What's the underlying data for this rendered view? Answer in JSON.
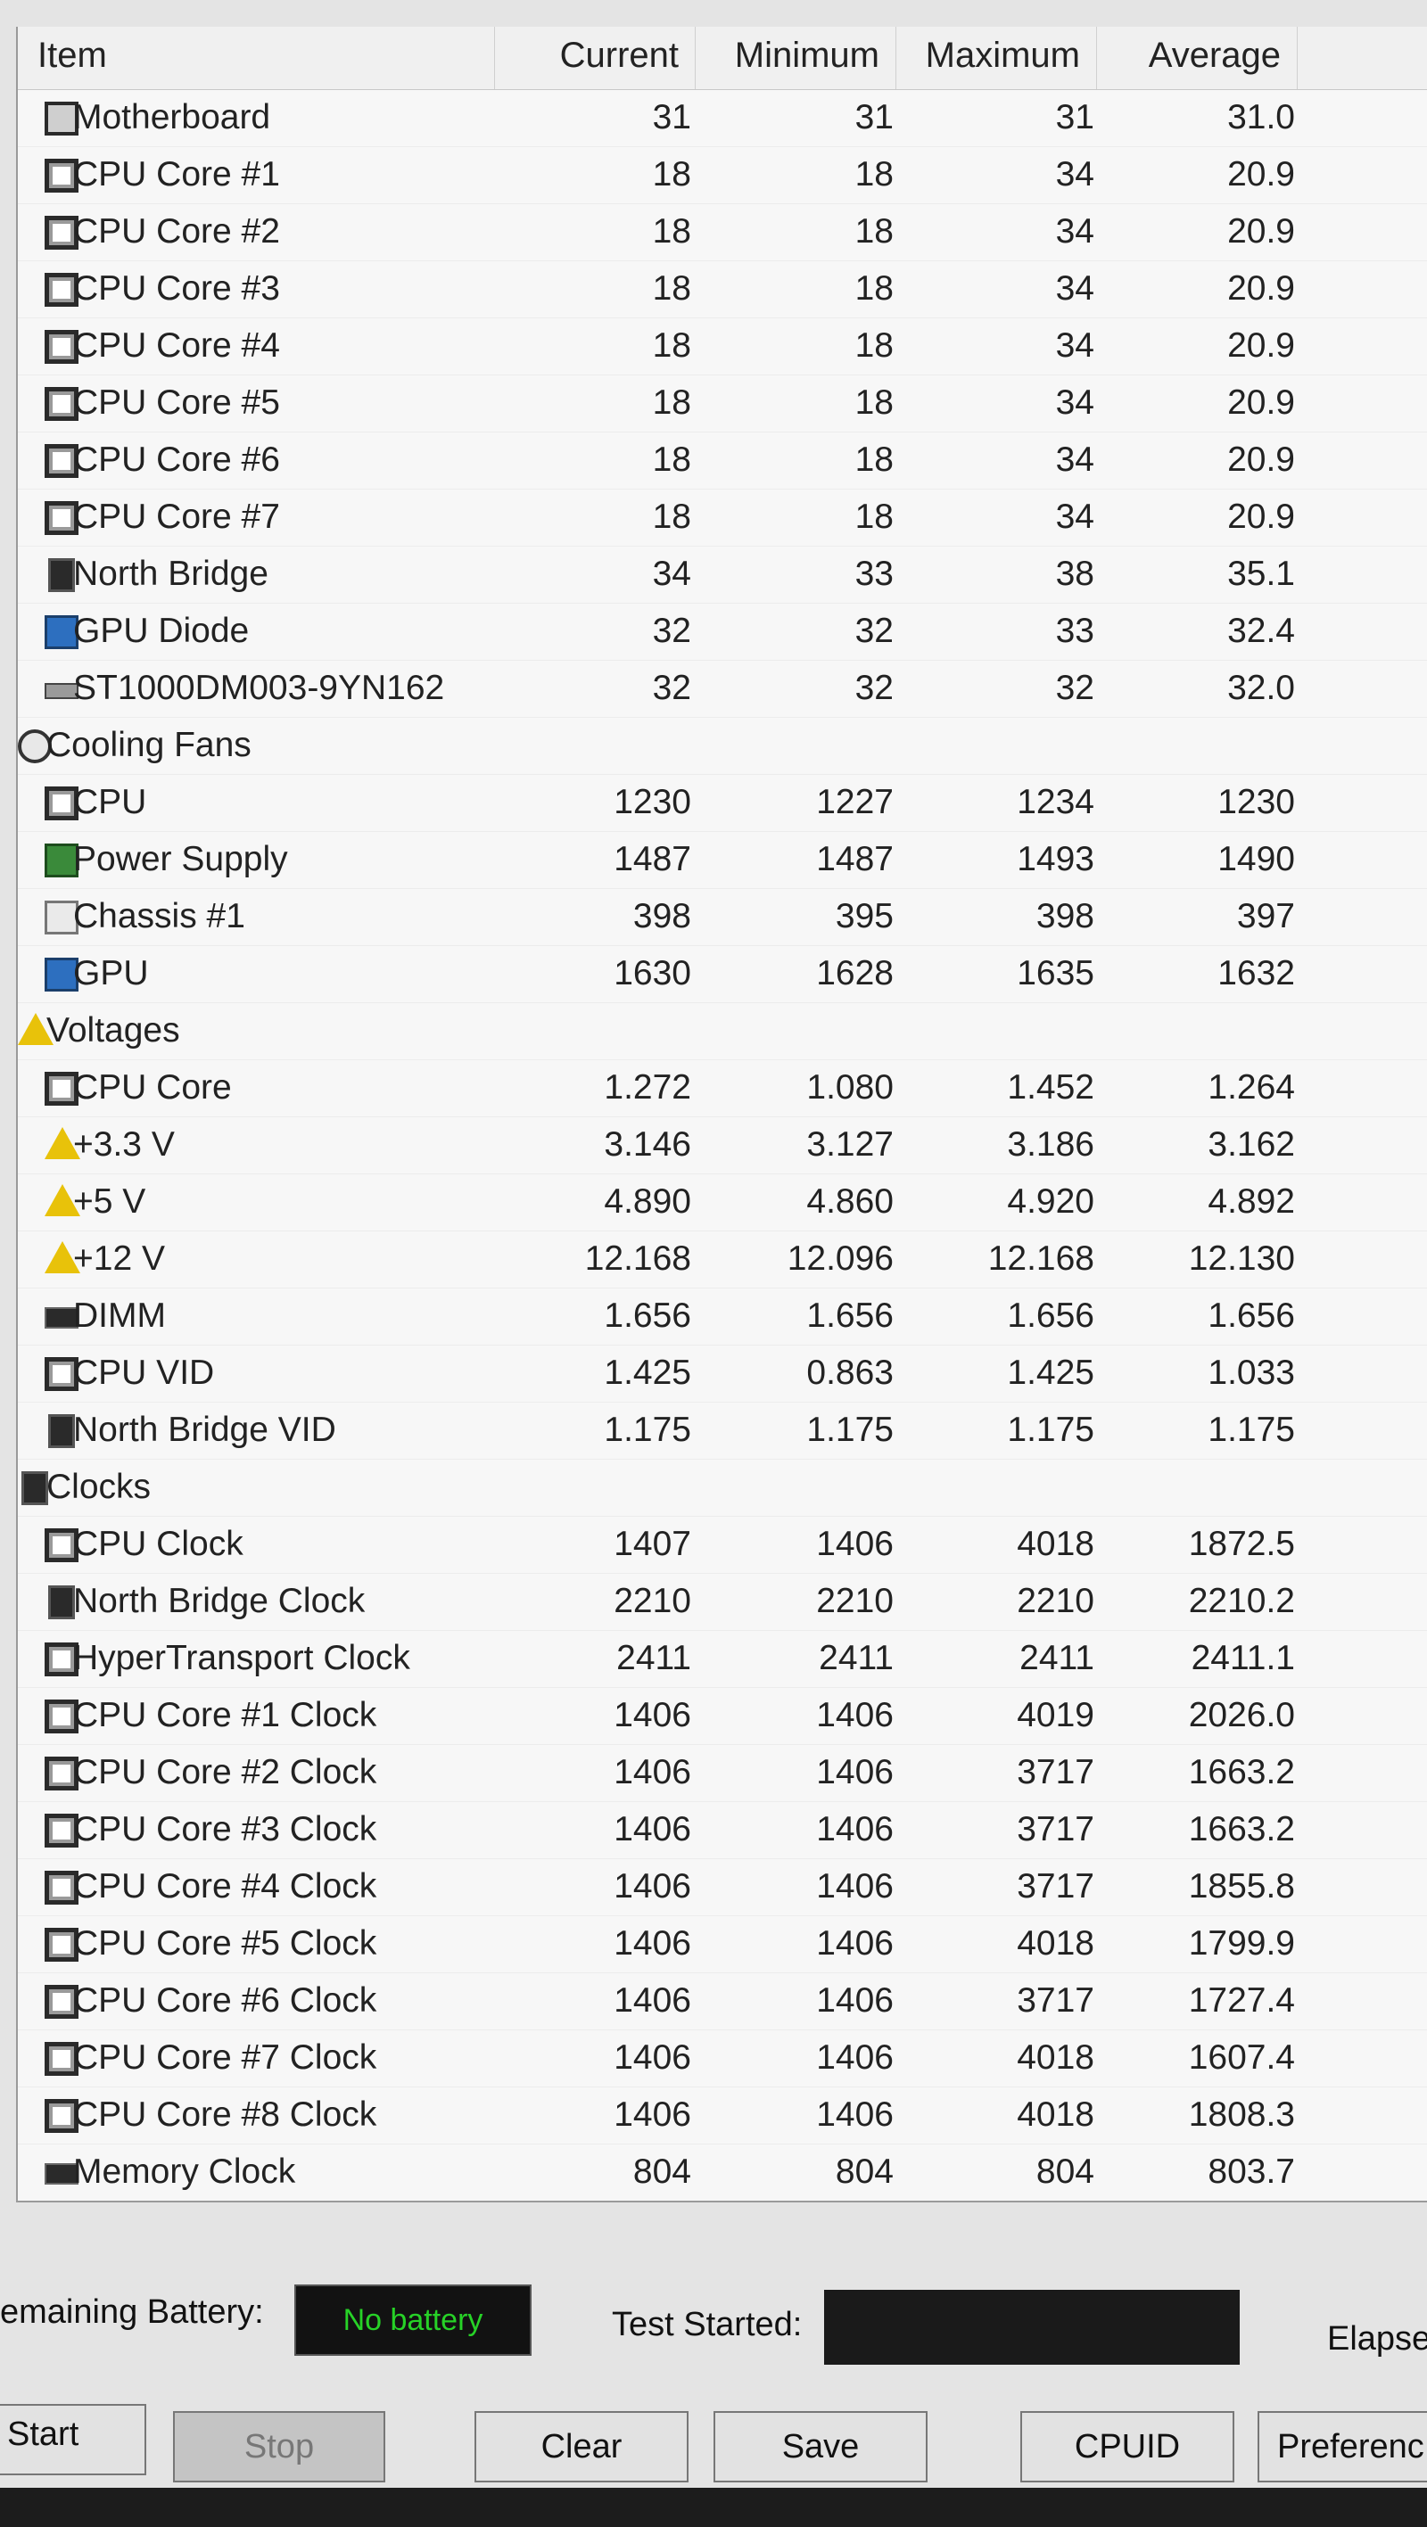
{
  "columns": {
    "item": "Item",
    "current": "Current",
    "minimum": "Minimum",
    "maximum": "Maximum",
    "average": "Average"
  },
  "rows": [
    {
      "label": "Motherboard",
      "level": 1,
      "icon": "motherboard-icon",
      "cur": "31",
      "min": "31",
      "max": "31",
      "avg": "31.0"
    },
    {
      "label": "CPU Core #1",
      "level": 1,
      "icon": "cpu-chip-icon",
      "cur": "18",
      "min": "18",
      "max": "34",
      "avg": "20.9"
    },
    {
      "label": "CPU Core #2",
      "level": 1,
      "icon": "cpu-chip-icon",
      "cur": "18",
      "min": "18",
      "max": "34",
      "avg": "20.9"
    },
    {
      "label": "CPU Core #3",
      "level": 1,
      "icon": "cpu-chip-icon",
      "cur": "18",
      "min": "18",
      "max": "34",
      "avg": "20.9"
    },
    {
      "label": "CPU Core #4",
      "level": 1,
      "icon": "cpu-chip-icon",
      "cur": "18",
      "min": "18",
      "max": "34",
      "avg": "20.9"
    },
    {
      "label": "CPU Core #5",
      "level": 1,
      "icon": "cpu-chip-icon",
      "cur": "18",
      "min": "18",
      "max": "34",
      "avg": "20.9"
    },
    {
      "label": "CPU Core #6",
      "level": 1,
      "icon": "cpu-chip-icon",
      "cur": "18",
      "min": "18",
      "max": "34",
      "avg": "20.9"
    },
    {
      "label": "CPU Core #7",
      "level": 1,
      "icon": "cpu-chip-icon",
      "cur": "18",
      "min": "18",
      "max": "34",
      "avg": "20.9"
    },
    {
      "label": "North Bridge",
      "level": 1,
      "icon": "north-bridge-icon",
      "cur": "34",
      "min": "33",
      "max": "38",
      "avg": "35.1"
    },
    {
      "label": "GPU Diode",
      "level": 1,
      "icon": "gpu-icon",
      "cur": "32",
      "min": "32",
      "max": "33",
      "avg": "32.4"
    },
    {
      "label": "ST1000DM003-9YN162",
      "level": 1,
      "icon": "hard-drive-icon",
      "cur": "32",
      "min": "32",
      "max": "32",
      "avg": "32.0"
    },
    {
      "label": "Cooling Fans",
      "level": 0,
      "icon": "fan-icon",
      "cur": "",
      "min": "",
      "max": "",
      "avg": ""
    },
    {
      "label": "CPU",
      "level": 1,
      "icon": "cpu-chip-icon",
      "cur": "1230",
      "min": "1227",
      "max": "1234",
      "avg": "1230"
    },
    {
      "label": "Power Supply",
      "level": 1,
      "icon": "power-supply-icon",
      "cur": "1487",
      "min": "1487",
      "max": "1493",
      "avg": "1490"
    },
    {
      "label": "Chassis #1",
      "level": 1,
      "icon": "chassis-icon",
      "cur": "398",
      "min": "395",
      "max": "398",
      "avg": "397"
    },
    {
      "label": "GPU",
      "level": 1,
      "icon": "gpu-icon",
      "cur": "1630",
      "min": "1628",
      "max": "1635",
      "avg": "1632"
    },
    {
      "label": "Voltages",
      "level": 0,
      "icon": "warning-icon",
      "cur": "",
      "min": "",
      "max": "",
      "avg": ""
    },
    {
      "label": "CPU Core",
      "level": 1,
      "icon": "cpu-chip-icon",
      "cur": "1.272",
      "min": "1.080",
      "max": "1.452",
      "avg": "1.264"
    },
    {
      "label": "+3.3 V",
      "level": 1,
      "icon": "warning-icon",
      "cur": "3.146",
      "min": "3.127",
      "max": "3.186",
      "avg": "3.162"
    },
    {
      "label": "+5 V",
      "level": 1,
      "icon": "warning-icon",
      "cur": "4.890",
      "min": "4.860",
      "max": "4.920",
      "avg": "4.892"
    },
    {
      "label": "+12 V",
      "level": 1,
      "icon": "warning-icon",
      "cur": "12.168",
      "min": "12.096",
      "max": "12.168",
      "avg": "12.130"
    },
    {
      "label": "DIMM",
      "level": 1,
      "icon": "memory-icon",
      "cur": "1.656",
      "min": "1.656",
      "max": "1.656",
      "avg": "1.656"
    },
    {
      "label": "CPU VID",
      "level": 1,
      "icon": "cpu-chip-icon",
      "cur": "1.425",
      "min": "0.863",
      "max": "1.425",
      "avg": "1.033"
    },
    {
      "label": "North Bridge VID",
      "level": 1,
      "icon": "north-bridge-icon",
      "cur": "1.175",
      "min": "1.175",
      "max": "1.175",
      "avg": "1.175"
    },
    {
      "label": "Clocks",
      "level": 0,
      "icon": "north-bridge-icon",
      "cur": "",
      "min": "",
      "max": "",
      "avg": ""
    },
    {
      "label": "CPU Clock",
      "level": 1,
      "icon": "cpu-chip-icon",
      "cur": "1407",
      "min": "1406",
      "max": "4018",
      "avg": "1872.5"
    },
    {
      "label": "North Bridge Clock",
      "level": 1,
      "icon": "north-bridge-icon",
      "cur": "2210",
      "min": "2210",
      "max": "2210",
      "avg": "2210.2"
    },
    {
      "label": "HyperTransport Clock",
      "level": 1,
      "icon": "cpu-chip-icon",
      "cur": "2411",
      "min": "2411",
      "max": "2411",
      "avg": "2411.1"
    },
    {
      "label": "CPU Core #1 Clock",
      "level": 1,
      "icon": "cpu-chip-icon",
      "cur": "1406",
      "min": "1406",
      "max": "4019",
      "avg": "2026.0"
    },
    {
      "label": "CPU Core #2 Clock",
      "level": 1,
      "icon": "cpu-chip-icon",
      "cur": "1406",
      "min": "1406",
      "max": "3717",
      "avg": "1663.2"
    },
    {
      "label": "CPU Core #3 Clock",
      "level": 1,
      "icon": "cpu-chip-icon",
      "cur": "1406",
      "min": "1406",
      "max": "3717",
      "avg": "1663.2"
    },
    {
      "label": "CPU Core #4 Clock",
      "level": 1,
      "icon": "cpu-chip-icon",
      "cur": "1406",
      "min": "1406",
      "max": "3717",
      "avg": "1855.8"
    },
    {
      "label": "CPU Core #5 Clock",
      "level": 1,
      "icon": "cpu-chip-icon",
      "cur": "1406",
      "min": "1406",
      "max": "4018",
      "avg": "1799.9"
    },
    {
      "label": "CPU Core #6 Clock",
      "level": 1,
      "icon": "cpu-chip-icon",
      "cur": "1406",
      "min": "1406",
      "max": "3717",
      "avg": "1727.4"
    },
    {
      "label": "CPU Core #7 Clock",
      "level": 1,
      "icon": "cpu-chip-icon",
      "cur": "1406",
      "min": "1406",
      "max": "4018",
      "avg": "1607.4"
    },
    {
      "label": "CPU Core #8 Clock",
      "level": 1,
      "icon": "cpu-chip-icon",
      "cur": "1406",
      "min": "1406",
      "max": "4018",
      "avg": "1808.3"
    },
    {
      "label": "Memory Clock",
      "level": 1,
      "icon": "memory-icon",
      "cur": "804",
      "min": "804",
      "max": "804",
      "avg": "803.7"
    }
  ],
  "status": {
    "battery_label": "emaining Battery:",
    "battery_value": "No battery",
    "battery_color": "#27d227",
    "test_started_label": "Test Started:",
    "elapsed_label": "Elapse"
  },
  "buttons": {
    "start": "Start",
    "stop": "Stop",
    "clear": "Clear",
    "save": "Save",
    "cpuid": "CPUID",
    "preferences": "Preferenc"
  }
}
